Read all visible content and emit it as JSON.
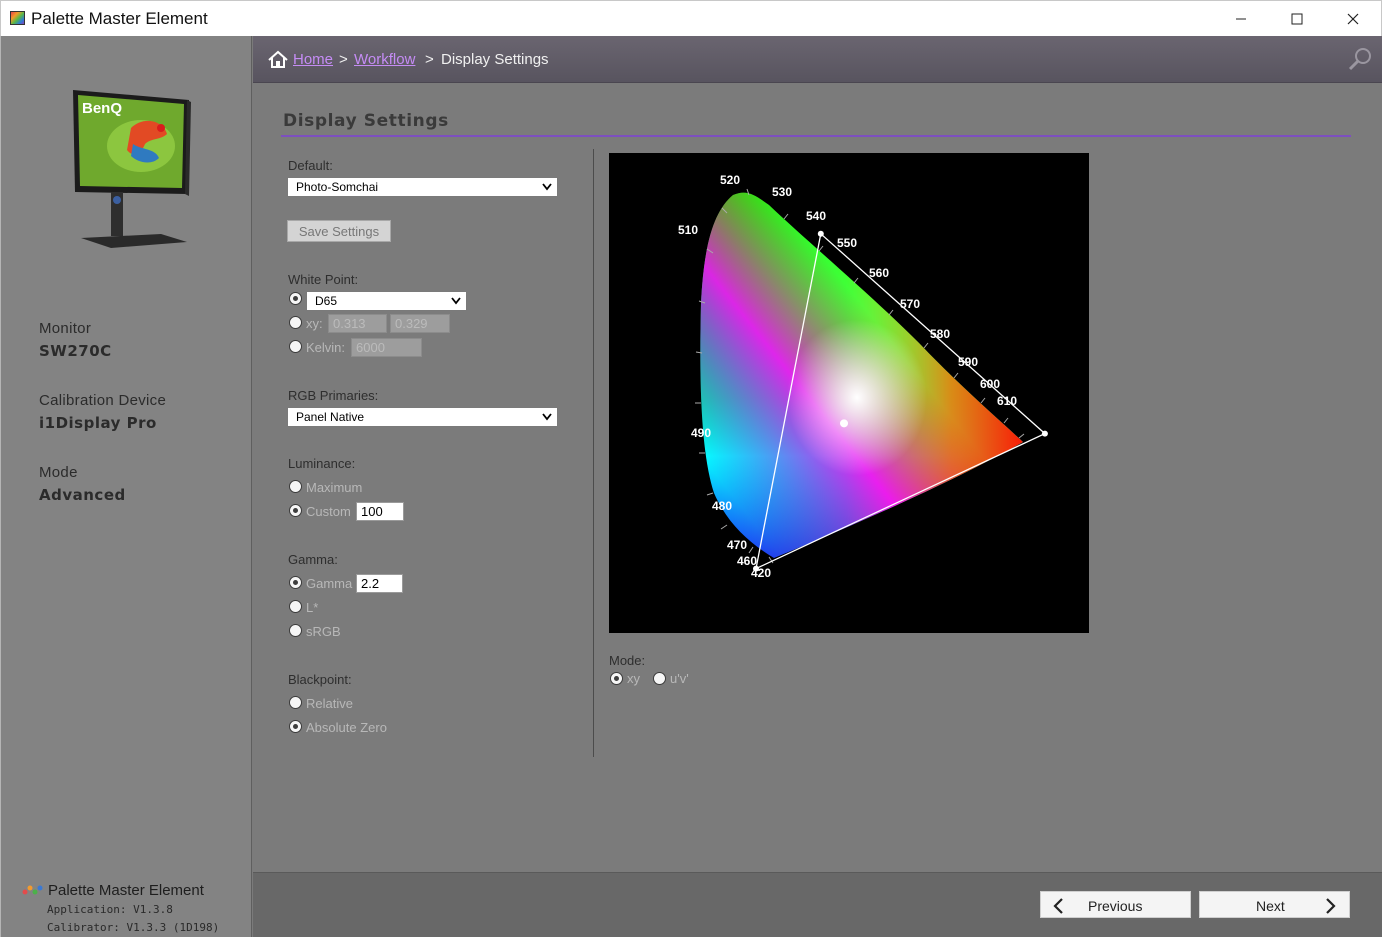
{
  "window": {
    "title": "Palette Master Element"
  },
  "sidebar": {
    "monitor_label": "Monitor",
    "monitor_value": "SW270C",
    "device_label": "Calibration Device",
    "device_value": "i1Display Pro",
    "mode_label": "Mode",
    "mode_value": "Advanced",
    "about_name": "Palette Master Element",
    "app_version": "Application: V1.3.8",
    "calibrator_version": "Calibrator: V1.3.3 (1D198)"
  },
  "breadcrumb": {
    "home": "Home",
    "sep1": ">",
    "workflow": "Workflow",
    "sep2": ">",
    "current": "Display Settings"
  },
  "settings": {
    "heading": "Display Settings",
    "default_label": "Default:",
    "default_value": "Photo-Somchai",
    "save_button": "Save Settings",
    "white_point_label": "White Point:",
    "wp_preset": "D65",
    "wp_xy_label": "xy:",
    "wp_x": "0.313",
    "wp_y": "0.329",
    "wp_kelvin_label": "Kelvin:",
    "wp_kelvin": "6000",
    "rgb_label": "RGB Primaries:",
    "rgb_value": "Panel Native",
    "luminance_label": "Luminance:",
    "lum_max": "Maximum",
    "lum_custom": "Custom",
    "lum_value": "100",
    "gamma_label": "Gamma:",
    "gamma_opt": "Gamma",
    "gamma_value": "2.2",
    "gamma_lstar": "L*",
    "gamma_srgb": "sRGB",
    "blackpoint_label": "Blackpoint:",
    "bp_relative": "Relative",
    "bp_absolute": "Absolute Zero",
    "mode_label": "Mode:",
    "mode_xy": "xy",
    "mode_uv": "u'v'"
  },
  "selected": {
    "white_point": "preset",
    "luminance": "custom",
    "gamma": "gamma",
    "blackpoint": "absolute",
    "chart_mode": "xy"
  },
  "cie_chart": {
    "wavelength_labels": [
      "420",
      "460",
      "470",
      "480",
      "490",
      "510",
      "520",
      "530",
      "540",
      "550",
      "560",
      "570",
      "580",
      "590",
      "600",
      "610"
    ],
    "gamut_triangle_xy": [
      [
        0.27,
        0.68
      ],
      [
        0.685,
        0.31
      ],
      [
        0.15,
        0.06
      ]
    ],
    "white_point_xy": [
      0.313,
      0.329
    ]
  },
  "footer": {
    "previous": "Previous",
    "next": "Next"
  },
  "colors": {
    "accent": "#7d4fc0",
    "link": "#c58cf5"
  }
}
